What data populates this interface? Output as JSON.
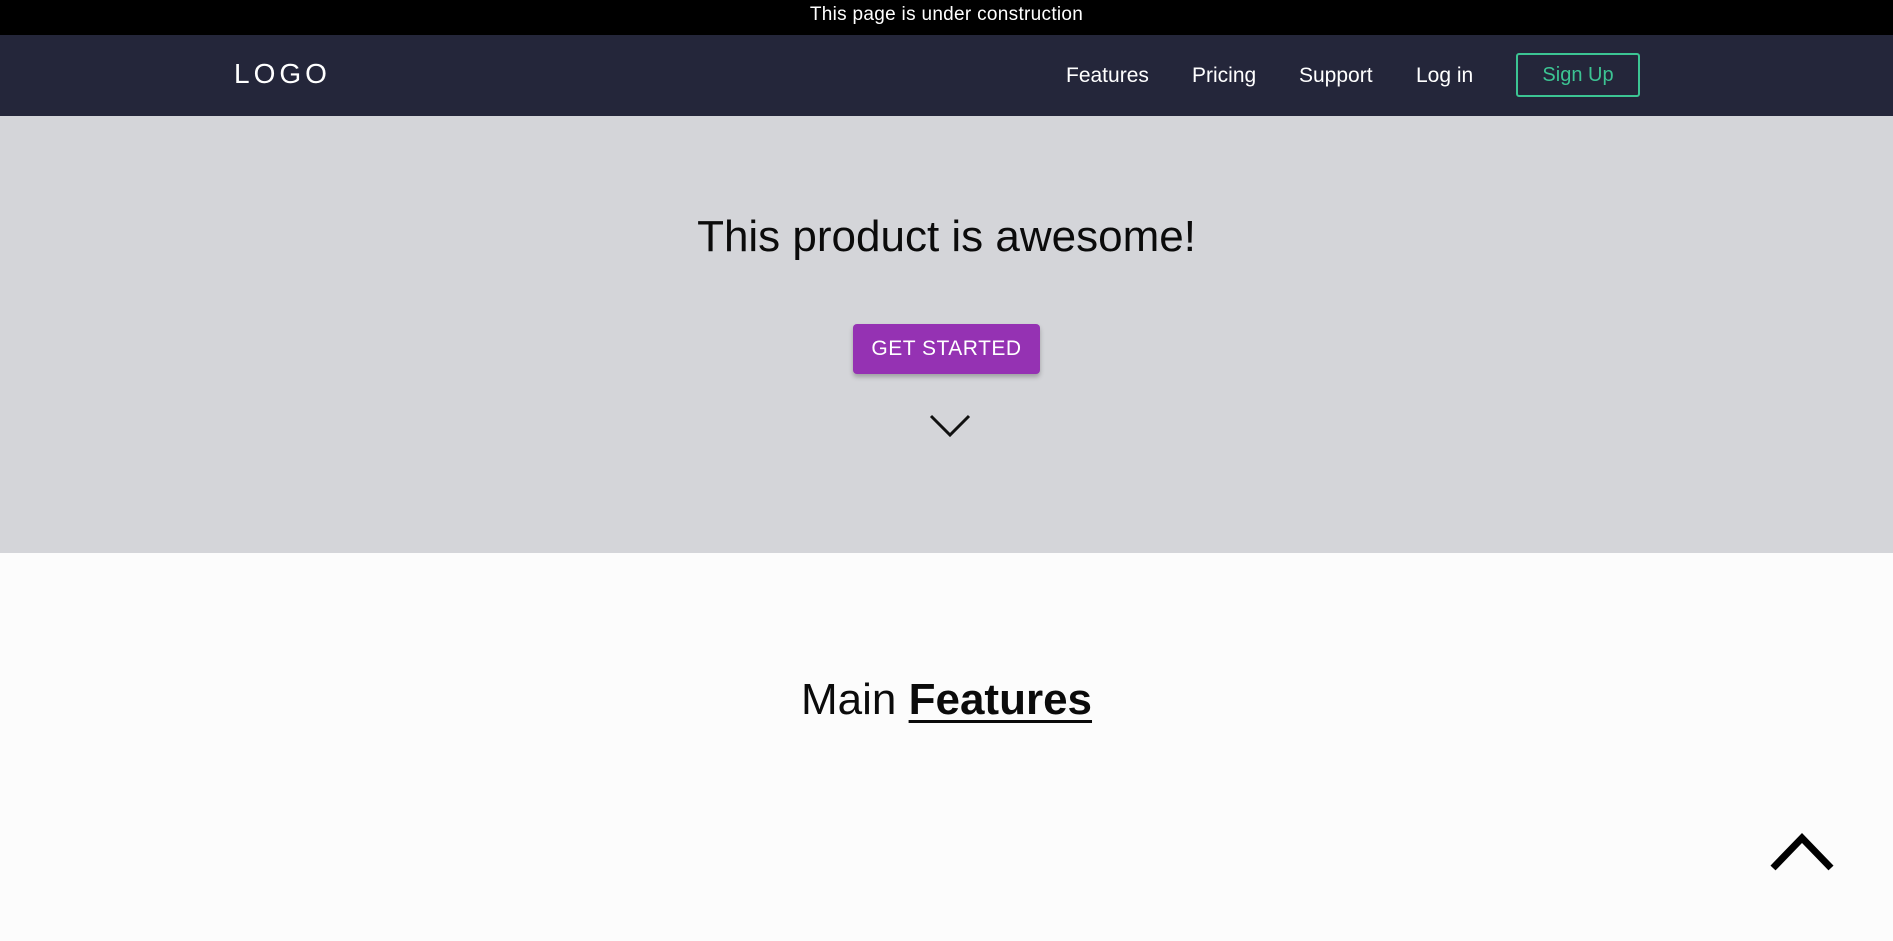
{
  "banner": {
    "text": "This page is under construction"
  },
  "navbar": {
    "logo": "LOGO",
    "links": [
      {
        "label": "Features"
      },
      {
        "label": "Pricing"
      },
      {
        "label": "Support"
      },
      {
        "label": "Log in"
      }
    ],
    "signup_label": "Sign Up"
  },
  "hero": {
    "title": "This product is awesome!",
    "cta_label": "GET STARTED",
    "scroll_icon": "chevron-down-icon"
  },
  "features": {
    "title_prefix": "Main",
    "title_emphasis": "Features"
  },
  "back_to_top_icon": "chevron-up-icon",
  "colors": {
    "banner_bg": "#000000",
    "navbar_bg": "#24263a",
    "hero_bg": "#d4d5d9",
    "cta_bg": "#9532b3",
    "signup_accent": "#3cc493",
    "page_bg": "#fcfcfc"
  }
}
